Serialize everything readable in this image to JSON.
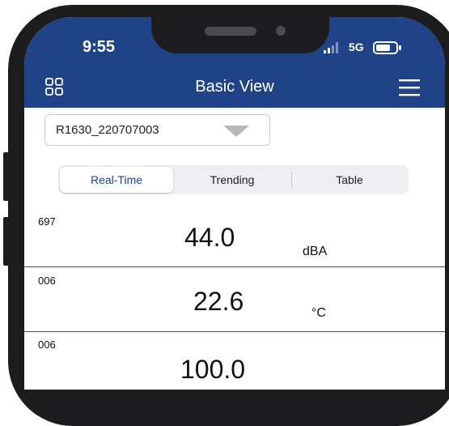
{
  "status_bar": {
    "time": "9:55",
    "network": "5G",
    "signal_icon": "signal-bars-icon",
    "battery_icon": "battery-icon"
  },
  "nav": {
    "title": "Basic View",
    "left_icon": "grid-menu-icon",
    "right_icon": "hamburger-menu-icon"
  },
  "device_select": {
    "value": "R1630_220707003",
    "icon": "dropdown-arrow-icon"
  },
  "tabs": [
    {
      "label": "Real-Time",
      "active": true
    },
    {
      "label": "Trending",
      "active": false
    },
    {
      "label": "Table",
      "active": false
    }
  ],
  "readings": [
    {
      "id": "697",
      "value": "44.0",
      "unit": "dBA"
    },
    {
      "id": "006",
      "value": "22.6",
      "unit": "°C"
    },
    {
      "id": "006",
      "value": "100.0",
      "unit": ""
    }
  ],
  "colors": {
    "header": "#1f4386",
    "frame": "#1c1c1e",
    "active_tab_text": "#1f4386"
  }
}
